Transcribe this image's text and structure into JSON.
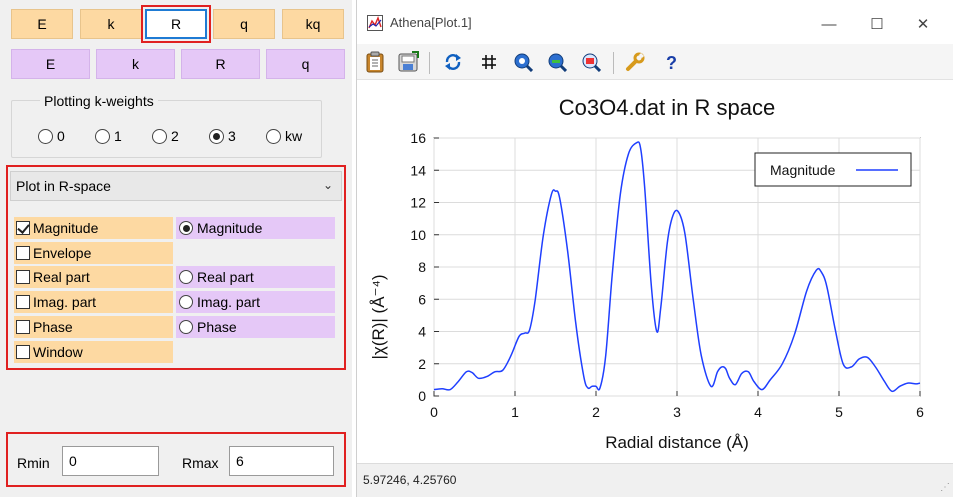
{
  "space_tabs_top": [
    {
      "label": "E",
      "selected": false
    },
    {
      "label": "k",
      "selected": false
    },
    {
      "label": "R",
      "selected": true
    },
    {
      "label": "q",
      "selected": false
    },
    {
      "label": "kq",
      "selected": false
    }
  ],
  "space_tabs_bottom": [
    "E",
    "k",
    "R",
    "q"
  ],
  "kweights": {
    "title": "Plotting k-weights",
    "options": [
      "0",
      "1",
      "2",
      "3",
      "kw"
    ],
    "selected": "3"
  },
  "plot_select": {
    "value": "Plot in R-space"
  },
  "parts_left": [
    {
      "label": "Magnitude",
      "checked": true
    },
    {
      "label": "Envelope",
      "checked": false
    },
    {
      "label": "Real part",
      "checked": false
    },
    {
      "label": "Imag. part",
      "checked": false
    },
    {
      "label": "Phase",
      "checked": false
    },
    {
      "label": "Window",
      "checked": false
    }
  ],
  "parts_right": [
    {
      "label": "Magnitude",
      "selected": true
    },
    {
      "label": "Real part",
      "selected": false
    },
    {
      "label": "Imag. part",
      "selected": false
    },
    {
      "label": "Phase",
      "selected": false
    }
  ],
  "range": {
    "rmin_label": "Rmin",
    "rmin_value": "0",
    "rmax_label": "Rmax",
    "rmax_value": "6"
  },
  "window": {
    "title": "Athena[Plot.1]",
    "minimize": "—",
    "maximize": "☐",
    "close": "✕"
  },
  "toolbar_icons": [
    "clipboard-icon",
    "save-image-icon",
    "refresh-icon",
    "grid-icon",
    "zoom-in-icon",
    "zoom-out-icon",
    "zoom-reset-icon",
    "settings-icon",
    "help-icon"
  ],
  "status": {
    "coords": "5.97246,  4.25760"
  },
  "colors": {
    "orange": "#fdd9a2",
    "purple": "#e5c8f7",
    "highlight": "#e02020",
    "series": "#1f3fff"
  },
  "chart_data": {
    "type": "line",
    "title": "Co3O4.dat in R space",
    "xlabel": "Radial distance    (Å)",
    "ylabel": "|χ(R)|    (Å⁻⁴)",
    "xlim": [
      0,
      6
    ],
    "ylim": [
      0,
      16
    ],
    "xticks": [
      0,
      1,
      2,
      3,
      4,
      5,
      6
    ],
    "yticks": [
      0,
      2,
      4,
      6,
      8,
      10,
      12,
      14,
      16
    ],
    "grid": true,
    "legend_position": "top-right",
    "series": [
      {
        "name": "Magnitude",
        "x": [
          0,
          0.1,
          0.2,
          0.3,
          0.4,
          0.47,
          0.55,
          0.65,
          0.75,
          0.85,
          0.95,
          1.05,
          1.12,
          1.18,
          1.25,
          1.35,
          1.45,
          1.5,
          1.55,
          1.65,
          1.75,
          1.85,
          1.9,
          1.95,
          2.0,
          2.05,
          2.12,
          2.2,
          2.3,
          2.4,
          2.5,
          2.55,
          2.6,
          2.68,
          2.75,
          2.8,
          2.88,
          2.95,
          3.02,
          3.1,
          3.2,
          3.3,
          3.42,
          3.5,
          3.55,
          3.6,
          3.65,
          3.72,
          3.8,
          3.88,
          3.95,
          4.05,
          4.15,
          4.3,
          4.45,
          4.6,
          4.72,
          4.78,
          4.85,
          4.95,
          5.05,
          5.15,
          5.25,
          5.35,
          5.45,
          5.55,
          5.65,
          5.75,
          5.85,
          5.95,
          6.0
        ],
        "y": [
          0.4,
          0.45,
          0.4,
          0.9,
          1.5,
          1.45,
          1.1,
          1.2,
          1.5,
          1.6,
          2.5,
          3.7,
          3.9,
          4.1,
          6.0,
          10.0,
          12.5,
          12.7,
          12.3,
          9.0,
          4.5,
          1.2,
          0.5,
          0.6,
          0.6,
          0.5,
          2.5,
          7.5,
          12.5,
          15.0,
          15.7,
          15.4,
          13.0,
          7.0,
          4.0,
          5.5,
          9.5,
          11.2,
          11.4,
          10.0,
          6.0,
          2.5,
          0.6,
          1.5,
          1.8,
          1.7,
          1.1,
          0.7,
          1.4,
          1.5,
          0.9,
          0.4,
          1.0,
          2.0,
          3.8,
          6.5,
          7.8,
          7.7,
          6.8,
          4.2,
          2.0,
          1.8,
          2.3,
          2.4,
          1.8,
          1.0,
          0.3,
          0.6,
          0.8,
          0.75,
          0.8
        ]
      }
    ]
  }
}
